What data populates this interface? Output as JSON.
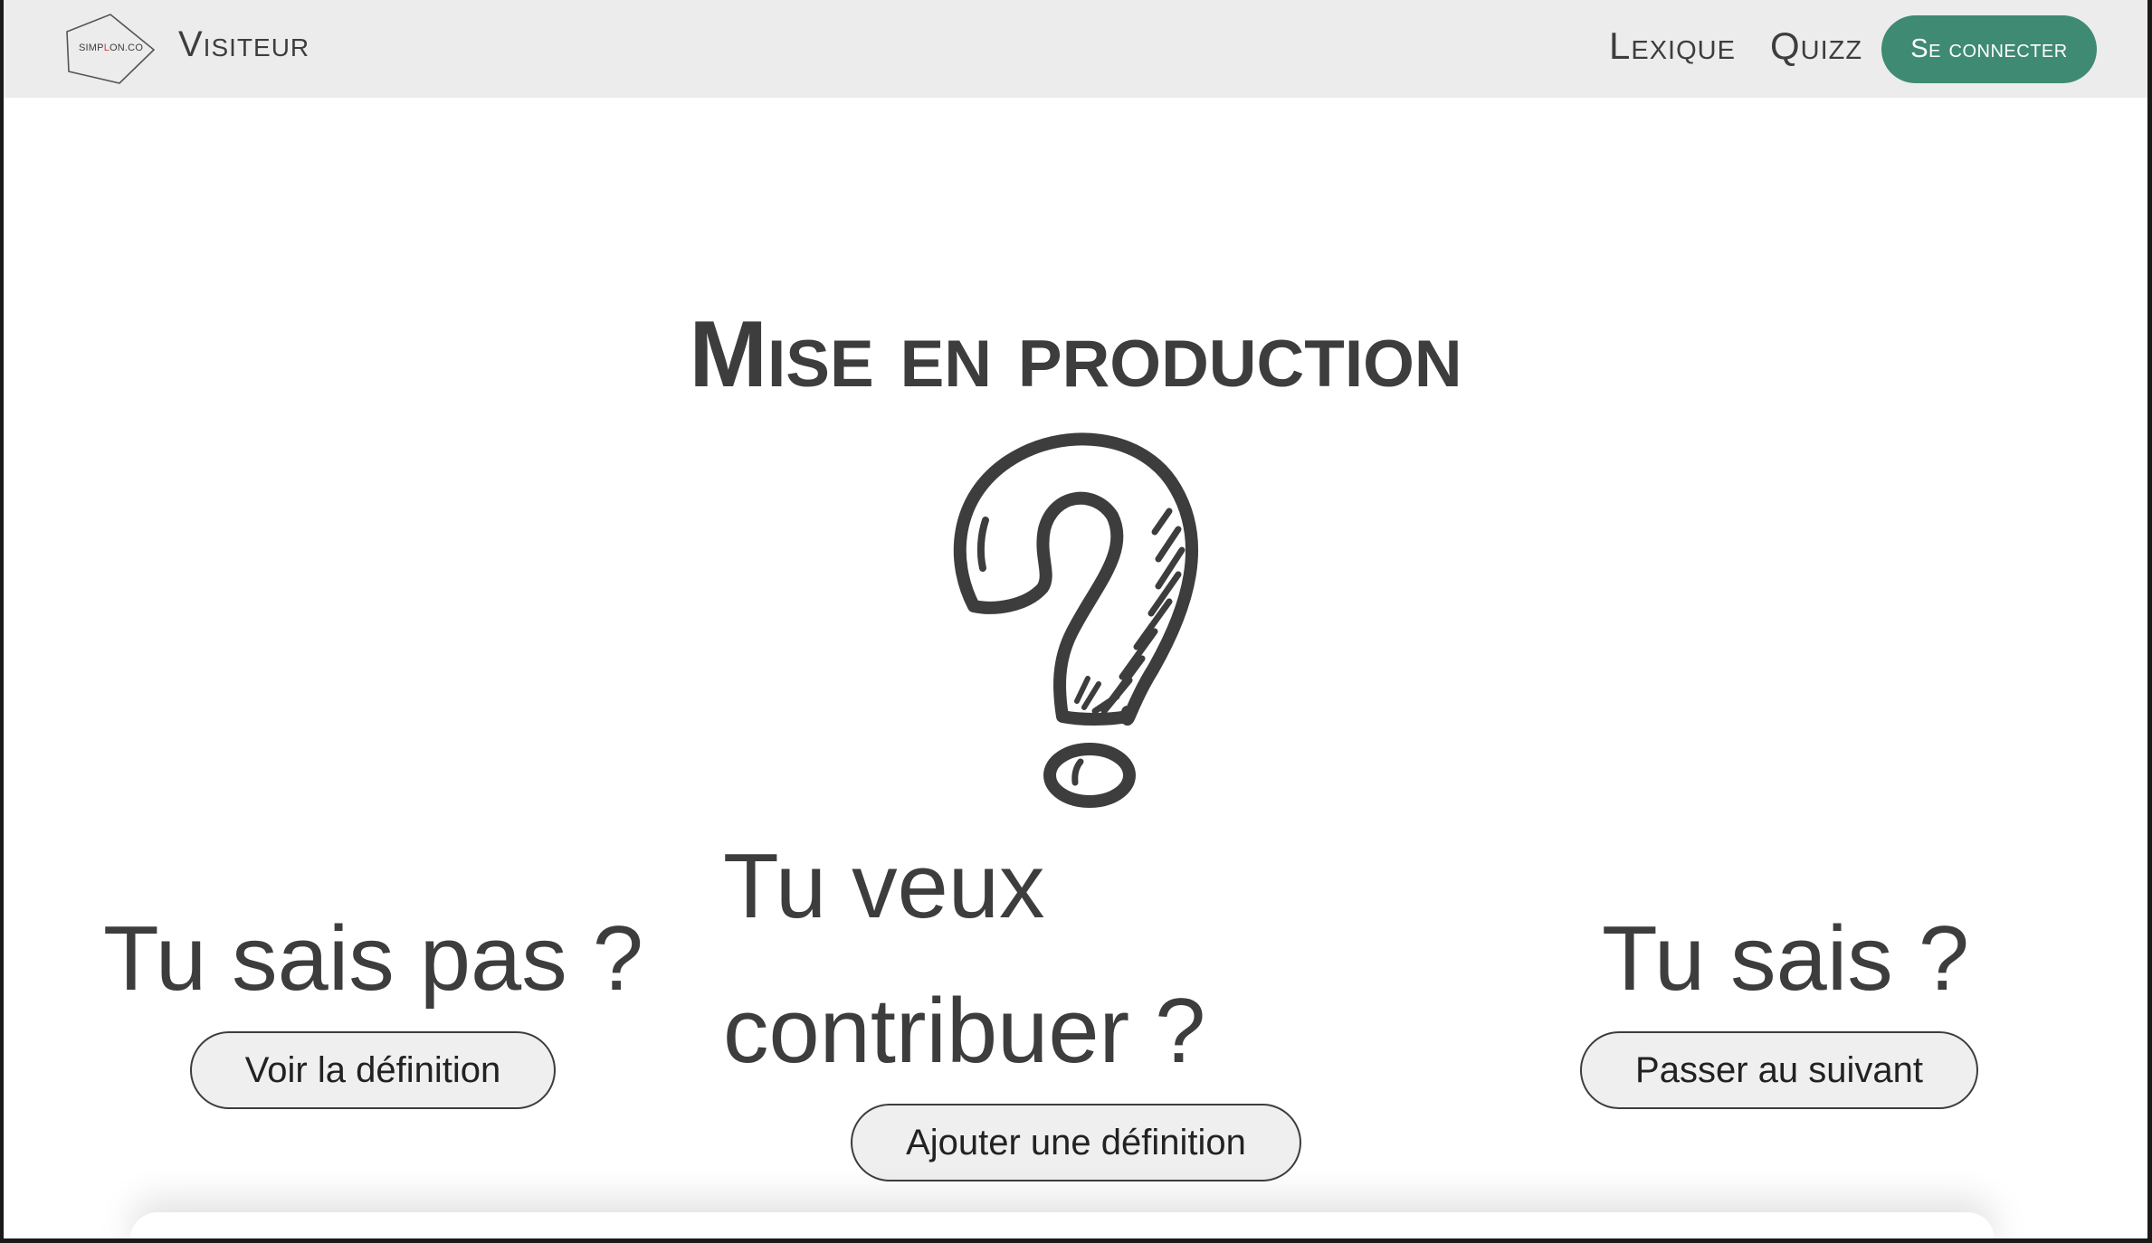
{
  "header": {
    "logo_text_before": "SIMP",
    "logo_text_red": "L",
    "logo_text_after": "ON.CO",
    "role": "Visiteur",
    "nav": [
      {
        "label": "Lexique"
      },
      {
        "label": "Quizz"
      }
    ],
    "connect_label": "Se connecter"
  },
  "main": {
    "term_title": "Mise en production",
    "left": {
      "text": "Tu sais pas ?",
      "button": "Voir la définition"
    },
    "middle": {
      "text": "Tu veux contribuer ?",
      "button": "Ajouter une définition"
    },
    "right": {
      "text": "Tu sais ?",
      "button": "Passer au suivant"
    }
  },
  "colors": {
    "accent": "#3f8a72",
    "header_bg": "#ececec",
    "text": "#3d3d3d",
    "logo_red": "#d9383e"
  },
  "icons": {
    "logo": "simplon-logo",
    "illustration": "question-mark-icon"
  }
}
